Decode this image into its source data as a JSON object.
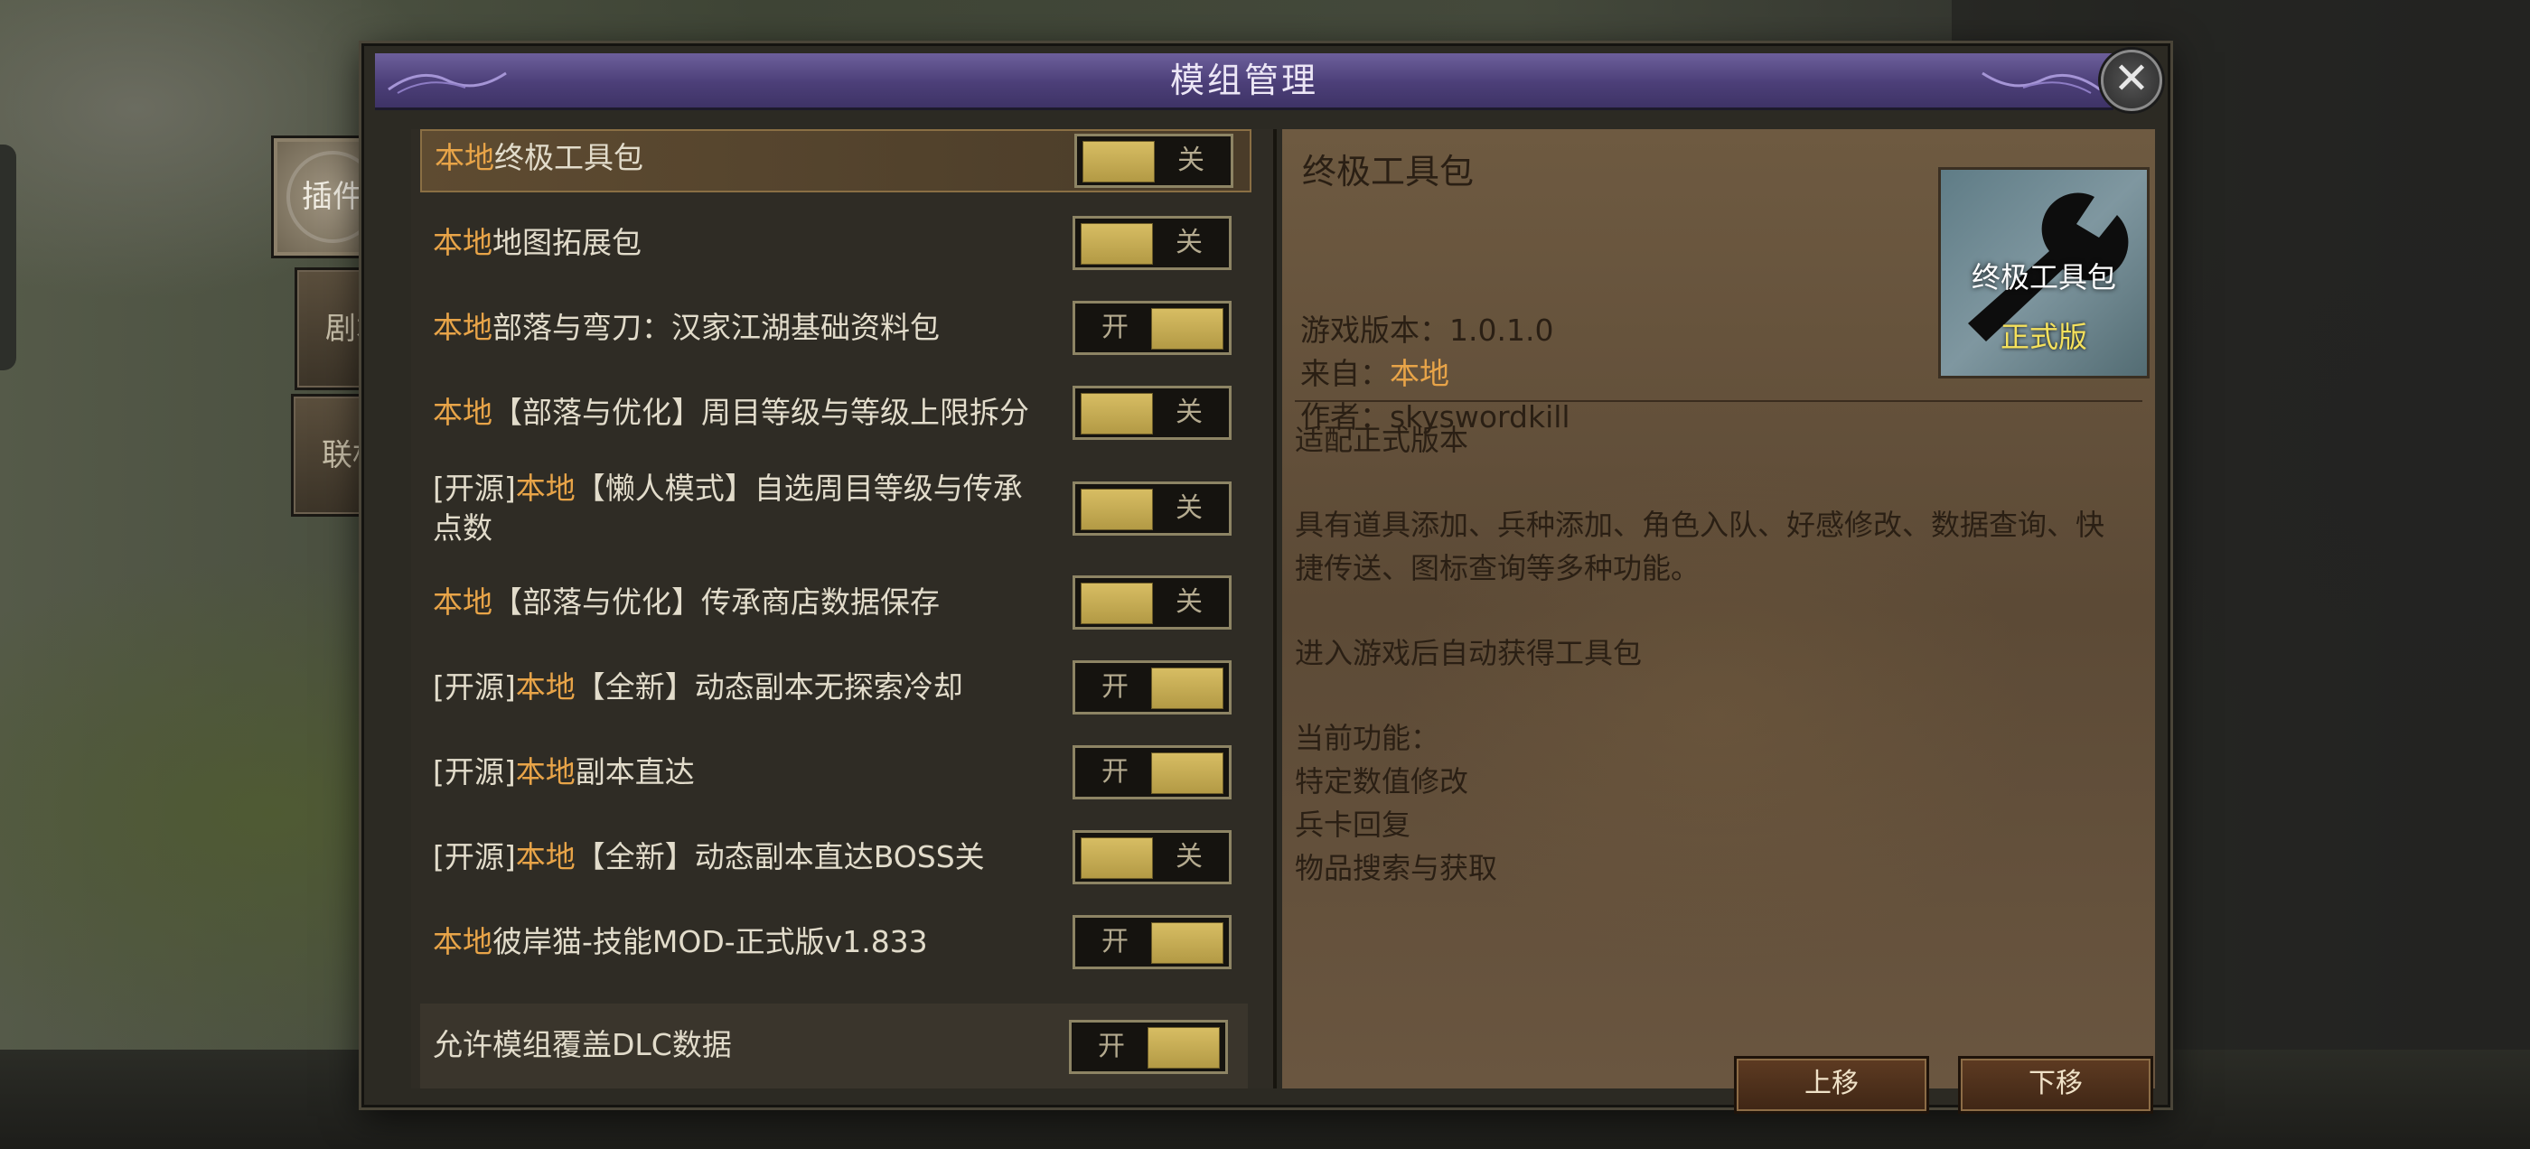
{
  "dialog": {
    "title": "模组管理",
    "close_symbol": "✕"
  },
  "side_tabs": [
    {
      "label": "插件",
      "active": true
    },
    {
      "label": "剧本",
      "active": false
    },
    {
      "label": "联机",
      "active": false
    }
  ],
  "toggle_labels": {
    "on": "开",
    "off": "关"
  },
  "mods": [
    {
      "prefix": "",
      "source": "本地",
      "name": "终极工具包",
      "state": "关",
      "selected": true
    },
    {
      "prefix": "",
      "source": "本地",
      "name": "地图拓展包",
      "state": "关"
    },
    {
      "prefix": "",
      "source": "本地",
      "name": "部落与弯刀：汉家江湖基础资料包",
      "state": "开"
    },
    {
      "prefix": "",
      "source": "本地",
      "name": "【部落与优化】周目等级与等级上限拆分",
      "state": "关"
    },
    {
      "prefix": "[开源]",
      "source": "本地",
      "name": "【懒人模式】自选周目等级与传承",
      "name_line2": "点数",
      "state": "关"
    },
    {
      "prefix": "",
      "source": "本地",
      "name": "【部落与优化】传承商店数据保存",
      "state": "关"
    },
    {
      "prefix": "[开源]",
      "source": "本地",
      "name": "【全新】动态副本无探索冷却",
      "state": "开"
    },
    {
      "prefix": "[开源]",
      "source": "本地",
      "name": "副本直达",
      "state": "开"
    },
    {
      "prefix": "[开源]",
      "source": "本地",
      "name": "【全新】动态副本直达BOSS关",
      "state": "关"
    },
    {
      "prefix": "",
      "source": "本地",
      "name": "彼岸猫-技能MOD-正式版v1.833",
      "state": "开"
    }
  ],
  "footer_option": {
    "label": "允许模组覆盖DLC数据",
    "state": "开"
  },
  "detail": {
    "title": "终极工具包",
    "version_label": "游戏版本：",
    "version": "1.0.1.0",
    "from_label": "来自：",
    "from": "本地",
    "author_label": "作者：",
    "author": "skyswordkill",
    "thumbnail": {
      "text": "终极工具包",
      "edition": "正式版",
      "icon": "wrench-icon"
    },
    "desc": [
      "适配正式版本",
      "具有道具添加、兵种添加、角色入队、好感修改、数据查询、快",
      "捷传送、图标查询等多种功能。",
      "进入游戏后自动获得工具包",
      "当前功能：",
      "特定数值修改",
      "兵卡回复",
      "物品搜索与获取"
    ],
    "move_up": "上移",
    "move_down": "下移"
  },
  "colors": {
    "accent_orange": "#e8a448",
    "title_purple": "#5a4c88",
    "toggle_gold": "#c9ae56"
  }
}
